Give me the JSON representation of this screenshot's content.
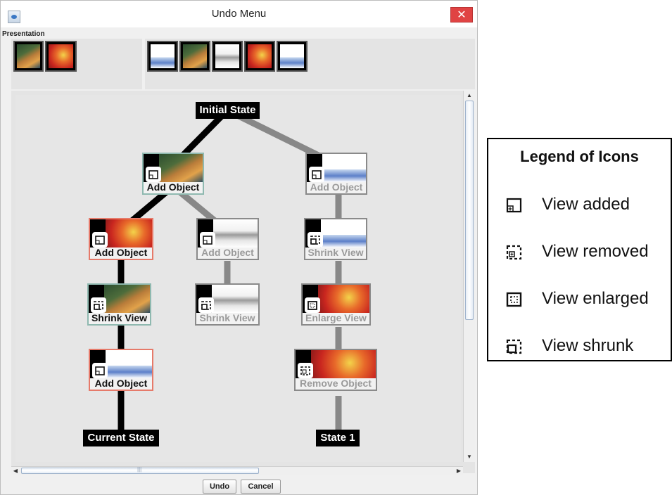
{
  "window": {
    "title": "Undo Menu",
    "close_glyph": "✕"
  },
  "presentation": {
    "label": "Presentation",
    "left_thumbs": [
      "map",
      "heat"
    ],
    "right_thumbs": [
      "plot",
      "map",
      "world",
      "heat",
      "plot"
    ]
  },
  "tree": {
    "root": "Initial State",
    "current": "Current State",
    "other_leaf": "State 1",
    "nodes": [
      {
        "action": "Add Object",
        "icon": "view-added-icon",
        "style": "teal",
        "shot": "map"
      },
      {
        "action": "Add Object",
        "icon": "view-added-icon",
        "style": "grey",
        "shot": "plot"
      },
      {
        "action": "Add Object",
        "icon": "view-added-icon",
        "style": "red",
        "shot": "heat"
      },
      {
        "action": "Add Object",
        "icon": "view-added-icon",
        "style": "grey",
        "shot": "world"
      },
      {
        "action": "Shrink View",
        "icon": "view-shrunk-icon",
        "style": "grey",
        "shot": "plot"
      },
      {
        "action": "Shrink View",
        "icon": "view-shrunk-icon",
        "style": "teal",
        "shot": "map"
      },
      {
        "action": "Shrink View",
        "icon": "view-shrunk-icon",
        "style": "grey",
        "shot": "world"
      },
      {
        "action": "Enlarge View",
        "icon": "view-enlarged-icon",
        "style": "grey",
        "shot": "heat"
      },
      {
        "action": "Add Object",
        "icon": "view-added-icon",
        "style": "red",
        "shot": "plot"
      },
      {
        "action": "Remove Object",
        "icon": "view-removed-icon",
        "style": "grey",
        "shot": "heat"
      }
    ]
  },
  "buttons": {
    "undo": "Undo",
    "cancel": "Cancel"
  },
  "scroll": {
    "grip": "|||"
  },
  "legend": {
    "title": "Legend of Icons",
    "items": [
      {
        "icon": "view-added-icon",
        "label": "View added"
      },
      {
        "icon": "view-removed-icon",
        "label": "View removed"
      },
      {
        "icon": "view-enlarged-icon",
        "label": "View enlarged"
      },
      {
        "icon": "view-shrunk-icon",
        "label": "View shrunk"
      }
    ]
  }
}
